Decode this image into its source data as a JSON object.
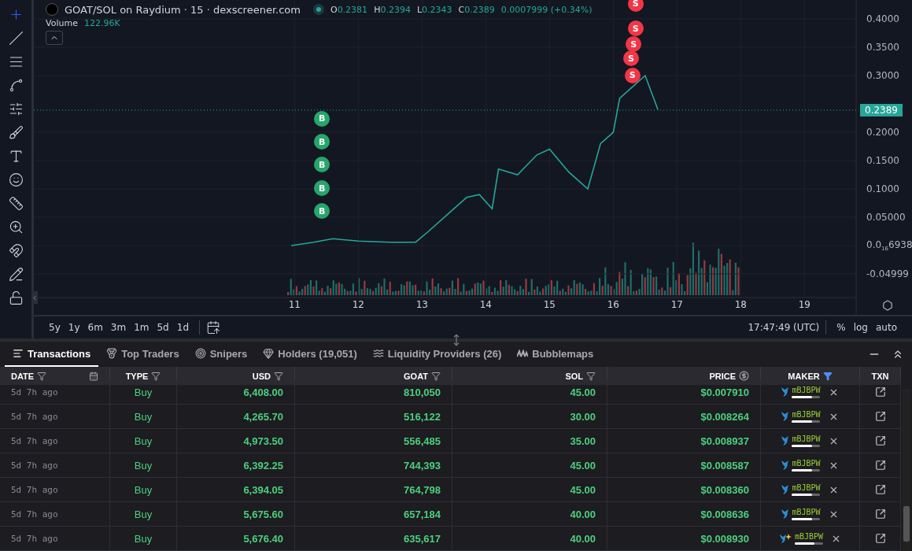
{
  "toolbar": {
    "tools": [
      {
        "selected": true
      },
      {
        "selected": false
      },
      {
        "selected": false
      },
      {
        "selected": false
      },
      {
        "selected": false
      },
      {
        "selected": false
      },
      {
        "selected": false
      },
      {
        "selected": false
      },
      {
        "selected": false
      },
      {
        "selected": false
      },
      {
        "selected": false
      },
      {
        "selected": false
      },
      {
        "selected": false
      }
    ]
  },
  "chart": {
    "title": "GOAT/SOL on Raydium · 15 · dexscreener.com",
    "live": true,
    "ohlc": [
      {
        "key": "O",
        "value": "0.2381"
      },
      {
        "key": "H",
        "value": "0.2394"
      },
      {
        "key": "L",
        "value": "0.2343"
      },
      {
        "key": "C",
        "value": "0.2389"
      }
    ],
    "change": "0.0007999 (+0.34%)",
    "volume_label": "Volume",
    "volume_value": "122.96K",
    "price_tag": "0.2389",
    "chart_data": {
      "type": "line",
      "x": [
        10.95,
        11.3,
        11.6,
        12.0,
        12.5,
        12.9,
        13.1,
        13.4,
        13.7,
        13.9,
        14.1,
        14.2,
        14.5,
        14.8,
        15.0,
        15.3,
        15.6,
        15.8,
        16.0,
        16.1,
        16.3,
        16.5,
        16.7
      ],
      "series": [
        {
          "color": "#26a69a",
          "values": [
            0.0,
            0.006,
            0.012,
            0.008,
            0.006,
            0.006,
            0.025,
            0.055,
            0.085,
            0.09,
            0.065,
            0.135,
            0.125,
            0.16,
            0.17,
            0.13,
            0.1,
            0.18,
            0.2,
            0.26,
            0.28,
            0.3,
            0.24
          ]
        }
      ],
      "xlim": [
        6.91,
        19.81
      ],
      "ylim": [
        -0.0917,
        0.4333
      ],
      "xticks": [
        11,
        12,
        13,
        14,
        15,
        16,
        17,
        18,
        19
      ],
      "yticks": [
        {
          "value": 0.4,
          "label": "0.4000"
        },
        {
          "value": 0.35,
          "label": "0.3500"
        },
        {
          "value": 0.3,
          "label": "0.3000"
        },
        {
          "value": 0.2,
          "label": "0.2000"
        },
        {
          "value": 0.15,
          "label": "0.1500"
        },
        {
          "value": 0.1,
          "label": "0.1000"
        },
        {
          "value": 0.05,
          "label": "0.05000"
        },
        {
          "value": 0.0,
          "label": "0.0$_{16}$6938"
        },
        {
          "value": -0.04999,
          "label": "-0.04999"
        }
      ],
      "grid": true,
      "annotations": [
        {
          "text": "B",
          "x": 11.43,
          "y": 0.224
        },
        {
          "text": "B",
          "x": 11.43,
          "y": 0.183
        },
        {
          "text": "B",
          "x": 11.43,
          "y": 0.143
        },
        {
          "text": "B",
          "x": 11.43,
          "y": 0.101
        },
        {
          "text": "B",
          "x": 11.43,
          "y": 0.061
        },
        {
          "text": "S",
          "x": 16.35,
          "y": 0.427
        },
        {
          "text": "S",
          "x": 16.35,
          "y": 0.383
        },
        {
          "text": "S",
          "x": 16.32,
          "y": 0.355
        },
        {
          "text": "S",
          "x": 16.28,
          "y": 0.33
        },
        {
          "text": "S",
          "x": 16.3,
          "y": 0.3
        }
      ]
    },
    "markers": [
      {
        "color": "#26a66b"
      },
      {
        "color": "#26a66b"
      },
      {
        "color": "#26a66b"
      },
      {
        "color": "#26a66b"
      },
      {
        "color": "#26a66b"
      },
      {
        "color": "#f23645"
      },
      {
        "color": "#f23645"
      },
      {
        "color": "#f23645"
      },
      {
        "color": "#f23645"
      },
      {
        "color": "#f23645"
      }
    ]
  },
  "range_buttons": [
    "5y",
    "1y",
    "6m",
    "3m",
    "1m",
    "5d",
    "1d"
  ],
  "clock": "17:47:49 (UTC)",
  "scale_buttons": [
    "%",
    "log",
    "auto"
  ],
  "tabs": [
    {
      "label": "Transactions",
      "selected": true
    },
    {
      "label": "Top Traders",
      "selected": false
    },
    {
      "label": "Snipers",
      "selected": false
    },
    {
      "label": "Holders (19,051)",
      "selected": false
    },
    {
      "label": "Liquidity Providers (26)",
      "selected": false
    },
    {
      "label": "Bubblemaps",
      "selected": false
    }
  ],
  "table": {
    "columns": [
      {
        "label": "DATE",
        "filter": true,
        "filter_active": false,
        "calendar": true
      },
      {
        "label": "TYPE",
        "filter": true,
        "filter_active": false
      },
      {
        "label": "USD",
        "filter": true,
        "filter_active": false
      },
      {
        "label": "GOAT",
        "filter": true,
        "filter_active": false
      },
      {
        "label": "SOL",
        "filter": true,
        "filter_active": false
      },
      {
        "label": "PRICE",
        "currency": true
      },
      {
        "label": "MAKER",
        "filter": true,
        "filter_active": true
      },
      {
        "label": "TXN"
      }
    ],
    "rows": [
      {
        "date": "5d 7h ago",
        "type": "Buy",
        "usd": "6,408.00",
        "goat": "810,050",
        "sol": "45.00",
        "price": "$0.007910",
        "maker": "mBJBPW",
        "level": 0.7,
        "new": false
      },
      {
        "date": "5d 7h ago",
        "type": "Buy",
        "usd": "4,265.70",
        "goat": "516,122",
        "sol": "30.00",
        "price": "$0.008264",
        "maker": "mBJBPW",
        "level": 0.7,
        "new": false
      },
      {
        "date": "5d 7h ago",
        "type": "Buy",
        "usd": "4,973.50",
        "goat": "556,485",
        "sol": "35.00",
        "price": "$0.008937",
        "maker": "mBJBPW",
        "level": 0.7,
        "new": false
      },
      {
        "date": "5d 7h ago",
        "type": "Buy",
        "usd": "6,392.25",
        "goat": "744,393",
        "sol": "45.00",
        "price": "$0.008587",
        "maker": "mBJBPW",
        "level": 0.7,
        "new": false
      },
      {
        "date": "5d 7h ago",
        "type": "Buy",
        "usd": "6,394.05",
        "goat": "764,798",
        "sol": "45.00",
        "price": "$0.008360",
        "maker": "mBJBPW",
        "level": 0.7,
        "new": false
      },
      {
        "date": "5d 7h ago",
        "type": "Buy",
        "usd": "5,675.60",
        "goat": "657,184",
        "sol": "40.00",
        "price": "$0.008636",
        "maker": "mBJBPW",
        "level": 0.7,
        "new": false
      },
      {
        "date": "5d 7h ago",
        "type": "Buy",
        "usd": "5,676.40",
        "goat": "635,617",
        "sol": "40.00",
        "price": "$0.008930",
        "maker": "mBJBPW",
        "level": 0.7,
        "new": true
      }
    ]
  }
}
